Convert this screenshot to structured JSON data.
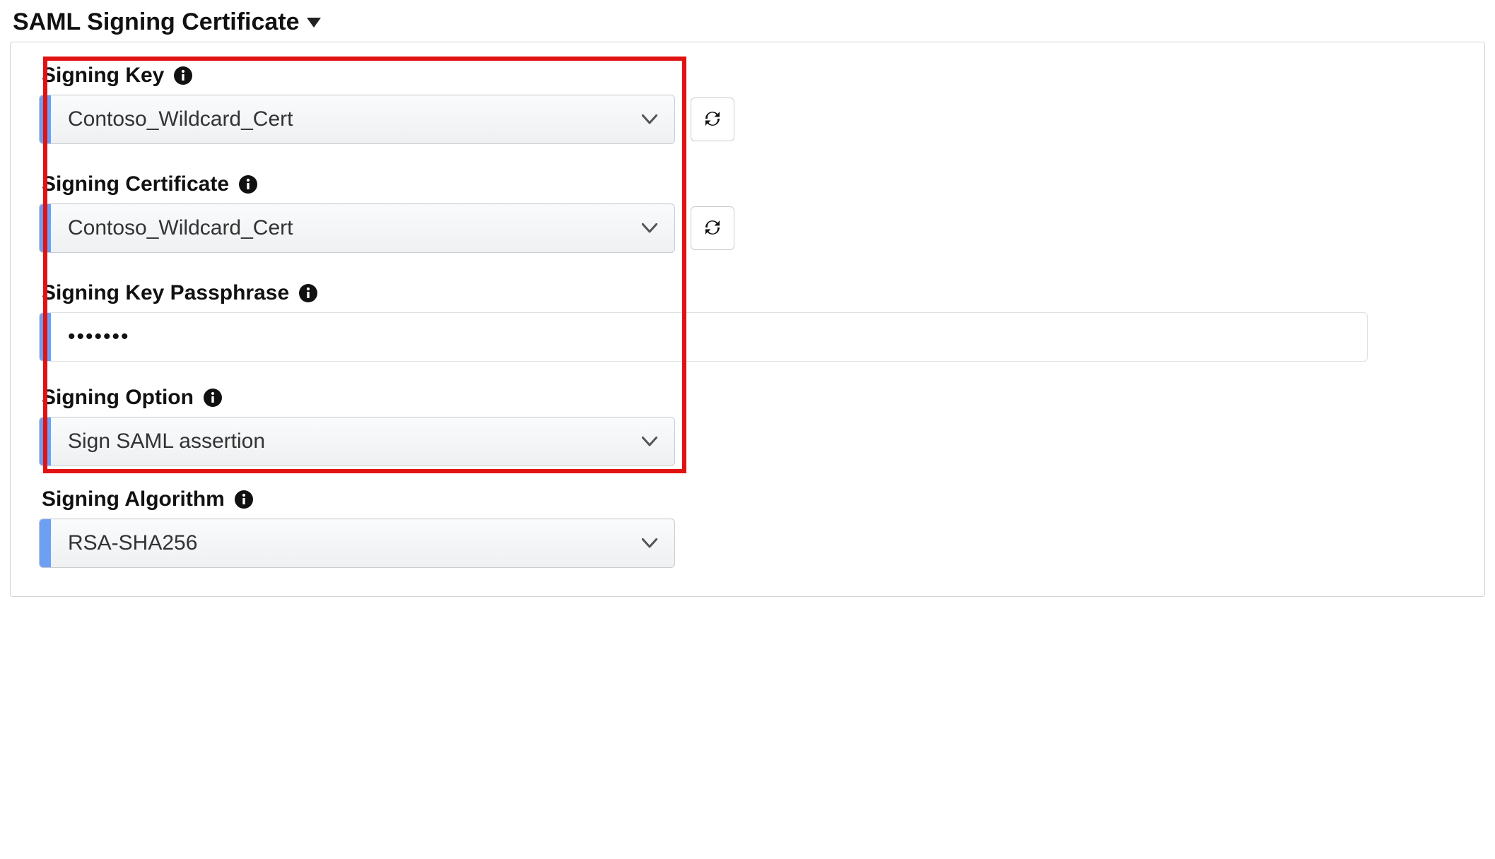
{
  "section": {
    "title": "SAML Signing Certificate"
  },
  "fields": {
    "signing_key": {
      "label": "Signing Key",
      "selected": "Contoso_Wildcard_Cert"
    },
    "signing_certificate": {
      "label": "Signing Certificate",
      "selected": "Contoso_Wildcard_Cert"
    },
    "signing_key_passphrase": {
      "label": "Signing Key Passphrase",
      "value": "•••••••"
    },
    "signing_option": {
      "label": "Signing Option",
      "selected": "Sign SAML assertion"
    },
    "signing_algorithm": {
      "label": "Signing Algorithm",
      "selected": "RSA-SHA256"
    }
  }
}
